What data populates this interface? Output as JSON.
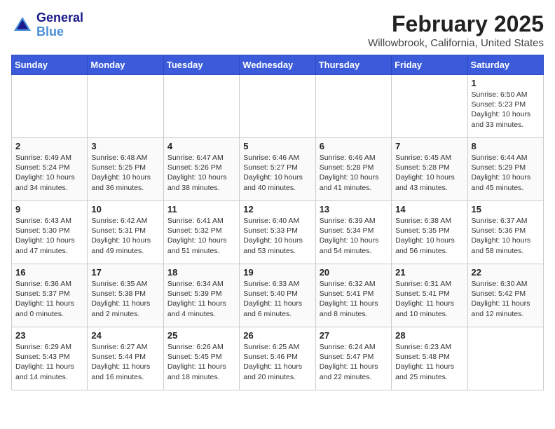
{
  "header": {
    "logo_line1": "General",
    "logo_line2": "Blue",
    "title": "February 2025",
    "subtitle": "Willowbrook, California, United States"
  },
  "weekdays": [
    "Sunday",
    "Monday",
    "Tuesday",
    "Wednesday",
    "Thursday",
    "Friday",
    "Saturday"
  ],
  "weeks": [
    [
      {
        "day": "",
        "info": ""
      },
      {
        "day": "",
        "info": ""
      },
      {
        "day": "",
        "info": ""
      },
      {
        "day": "",
        "info": ""
      },
      {
        "day": "",
        "info": ""
      },
      {
        "day": "",
        "info": ""
      },
      {
        "day": "1",
        "info": "Sunrise: 6:50 AM\nSunset: 5:23 PM\nDaylight: 10 hours\nand 33 minutes."
      }
    ],
    [
      {
        "day": "2",
        "info": "Sunrise: 6:49 AM\nSunset: 5:24 PM\nDaylight: 10 hours\nand 34 minutes."
      },
      {
        "day": "3",
        "info": "Sunrise: 6:48 AM\nSunset: 5:25 PM\nDaylight: 10 hours\nand 36 minutes."
      },
      {
        "day": "4",
        "info": "Sunrise: 6:47 AM\nSunset: 5:26 PM\nDaylight: 10 hours\nand 38 minutes."
      },
      {
        "day": "5",
        "info": "Sunrise: 6:46 AM\nSunset: 5:27 PM\nDaylight: 10 hours\nand 40 minutes."
      },
      {
        "day": "6",
        "info": "Sunrise: 6:46 AM\nSunset: 5:28 PM\nDaylight: 10 hours\nand 41 minutes."
      },
      {
        "day": "7",
        "info": "Sunrise: 6:45 AM\nSunset: 5:28 PM\nDaylight: 10 hours\nand 43 minutes."
      },
      {
        "day": "8",
        "info": "Sunrise: 6:44 AM\nSunset: 5:29 PM\nDaylight: 10 hours\nand 45 minutes."
      }
    ],
    [
      {
        "day": "9",
        "info": "Sunrise: 6:43 AM\nSunset: 5:30 PM\nDaylight: 10 hours\nand 47 minutes."
      },
      {
        "day": "10",
        "info": "Sunrise: 6:42 AM\nSunset: 5:31 PM\nDaylight: 10 hours\nand 49 minutes."
      },
      {
        "day": "11",
        "info": "Sunrise: 6:41 AM\nSunset: 5:32 PM\nDaylight: 10 hours\nand 51 minutes."
      },
      {
        "day": "12",
        "info": "Sunrise: 6:40 AM\nSunset: 5:33 PM\nDaylight: 10 hours\nand 53 minutes."
      },
      {
        "day": "13",
        "info": "Sunrise: 6:39 AM\nSunset: 5:34 PM\nDaylight: 10 hours\nand 54 minutes."
      },
      {
        "day": "14",
        "info": "Sunrise: 6:38 AM\nSunset: 5:35 PM\nDaylight: 10 hours\nand 56 minutes."
      },
      {
        "day": "15",
        "info": "Sunrise: 6:37 AM\nSunset: 5:36 PM\nDaylight: 10 hours\nand 58 minutes."
      }
    ],
    [
      {
        "day": "16",
        "info": "Sunrise: 6:36 AM\nSunset: 5:37 PM\nDaylight: 11 hours\nand 0 minutes."
      },
      {
        "day": "17",
        "info": "Sunrise: 6:35 AM\nSunset: 5:38 PM\nDaylight: 11 hours\nand 2 minutes."
      },
      {
        "day": "18",
        "info": "Sunrise: 6:34 AM\nSunset: 5:39 PM\nDaylight: 11 hours\nand 4 minutes."
      },
      {
        "day": "19",
        "info": "Sunrise: 6:33 AM\nSunset: 5:40 PM\nDaylight: 11 hours\nand 6 minutes."
      },
      {
        "day": "20",
        "info": "Sunrise: 6:32 AM\nSunset: 5:41 PM\nDaylight: 11 hours\nand 8 minutes."
      },
      {
        "day": "21",
        "info": "Sunrise: 6:31 AM\nSunset: 5:41 PM\nDaylight: 11 hours\nand 10 minutes."
      },
      {
        "day": "22",
        "info": "Sunrise: 6:30 AM\nSunset: 5:42 PM\nDaylight: 11 hours\nand 12 minutes."
      }
    ],
    [
      {
        "day": "23",
        "info": "Sunrise: 6:29 AM\nSunset: 5:43 PM\nDaylight: 11 hours\nand 14 minutes."
      },
      {
        "day": "24",
        "info": "Sunrise: 6:27 AM\nSunset: 5:44 PM\nDaylight: 11 hours\nand 16 minutes."
      },
      {
        "day": "25",
        "info": "Sunrise: 6:26 AM\nSunset: 5:45 PM\nDaylight: 11 hours\nand 18 minutes."
      },
      {
        "day": "26",
        "info": "Sunrise: 6:25 AM\nSunset: 5:46 PM\nDaylight: 11 hours\nand 20 minutes."
      },
      {
        "day": "27",
        "info": "Sunrise: 6:24 AM\nSunset: 5:47 PM\nDaylight: 11 hours\nand 22 minutes."
      },
      {
        "day": "28",
        "info": "Sunrise: 6:23 AM\nSunset: 5:48 PM\nDaylight: 11 hours\nand 25 minutes."
      },
      {
        "day": "",
        "info": ""
      }
    ]
  ]
}
